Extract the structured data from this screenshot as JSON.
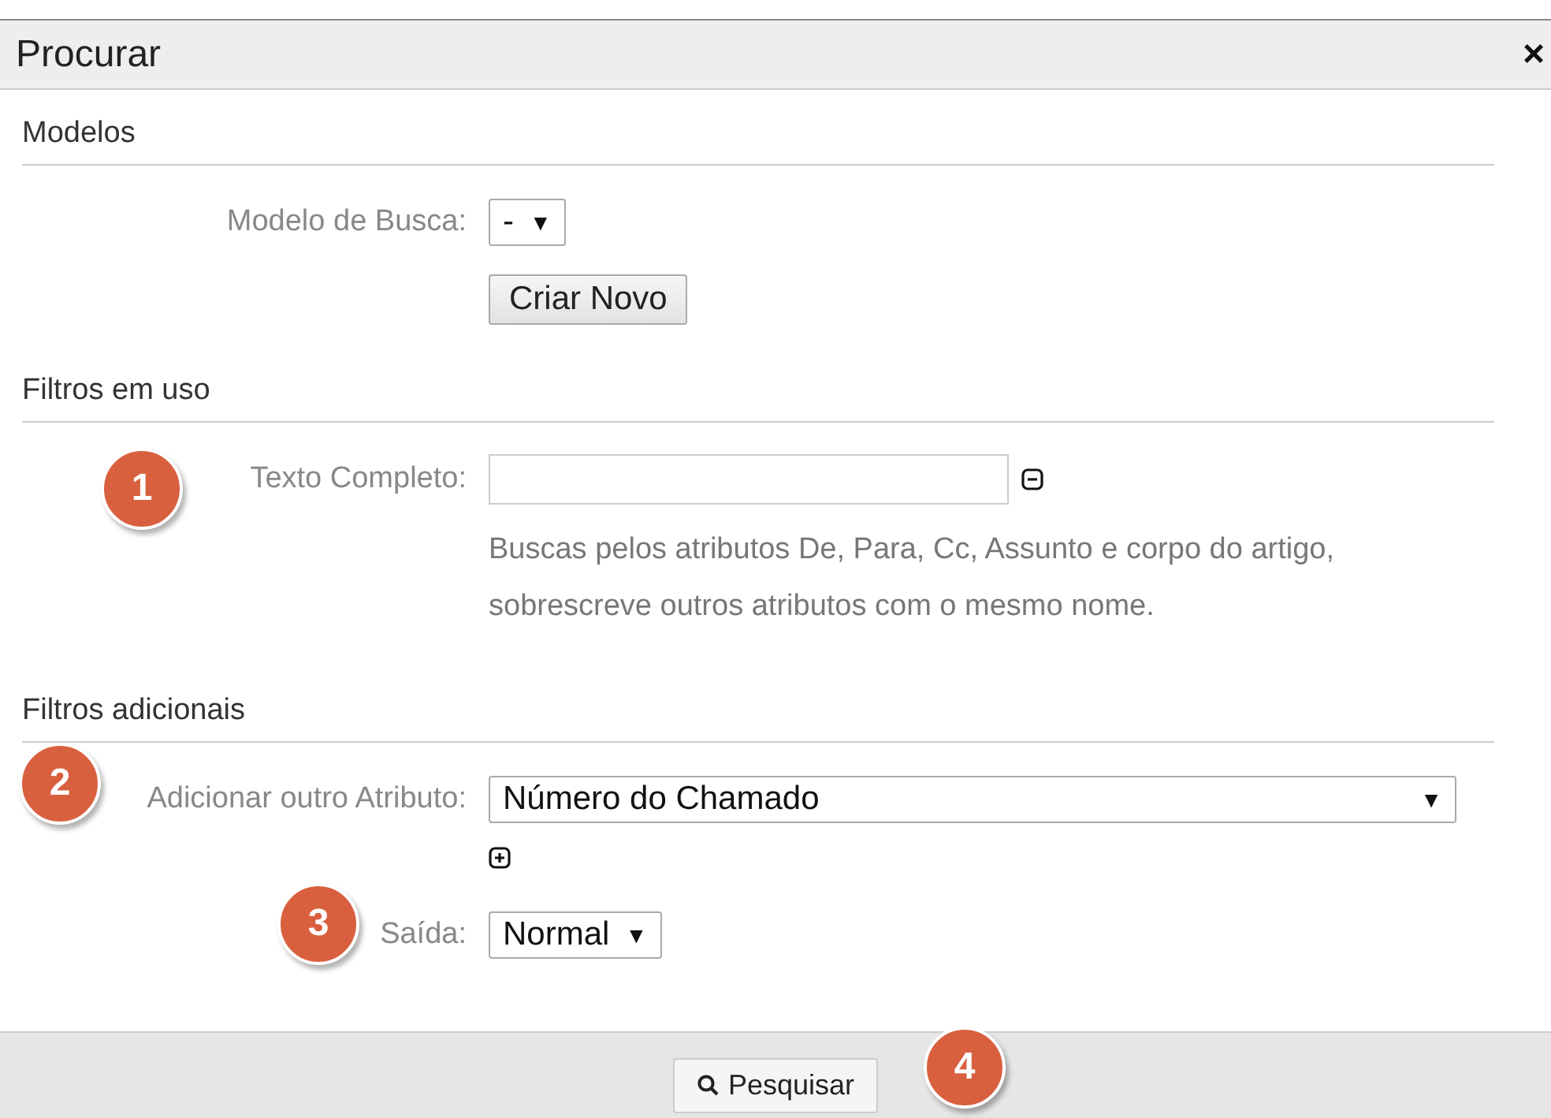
{
  "dialog": {
    "title": "Procurar",
    "close": "×"
  },
  "sections": [
    {
      "heading": "Modelos",
      "rows": [
        {
          "kind": "select",
          "label": "Modelo de Busca:",
          "value": "-",
          "caret": "▼"
        },
        {
          "kind": "button",
          "text": "Criar Novo"
        }
      ]
    },
    {
      "heading": "Filtros em uso",
      "rows": [
        {
          "kind": "text",
          "label": "Texto Completo:",
          "removable": true
        },
        {
          "kind": "help",
          "text": "Buscas pelos atributos De, Para, Cc, Assunto e corpo do artigo, sobrescreve outros atributos com o mesmo nome."
        }
      ]
    },
    {
      "heading": "Filtros adicionais",
      "rows": [
        {
          "kind": "wide-select",
          "label": "Adicionar outro Atributo:",
          "value": "Número do Chamado",
          "caret": "▼"
        },
        {
          "kind": "add"
        },
        {
          "kind": "select",
          "label": "Saída:",
          "value": "Normal",
          "caret": "▼"
        }
      ]
    }
  ],
  "footer": {
    "button": "Pesquisar"
  },
  "callouts": [
    {
      "number": "1"
    },
    {
      "number": "2"
    },
    {
      "number": "3"
    },
    {
      "number": "4"
    }
  ]
}
